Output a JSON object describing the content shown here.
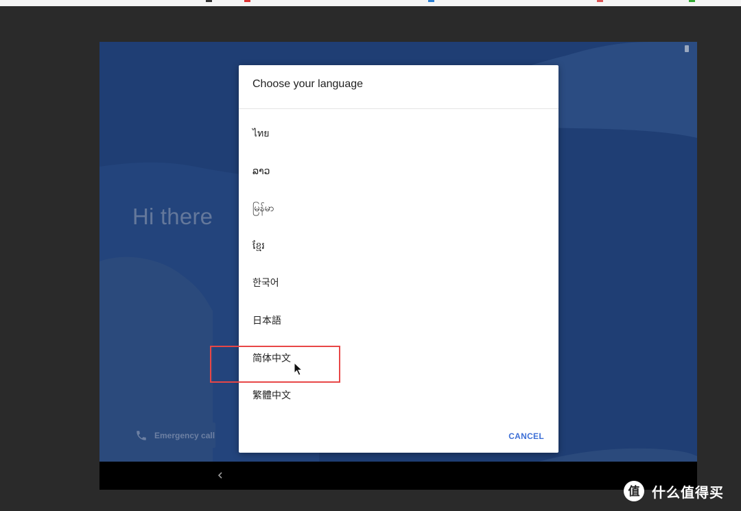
{
  "setup_screen": {
    "greeting": "Hi there",
    "emergency_call_label": "Emergency call",
    "colors": {
      "background": "#1f3e74",
      "greeting_text": "#64789b"
    }
  },
  "language_dialog": {
    "title": "Choose your language",
    "languages": [
      {
        "label": "ไทย"
      },
      {
        "label": "ລາວ"
      },
      {
        "label": "မြန်မာ"
      },
      {
        "label": "ខ្មែរ"
      },
      {
        "label": "한국어"
      },
      {
        "label": "日本語"
      },
      {
        "label": "简体中文",
        "highlighted": true
      },
      {
        "label": "繁體中文"
      }
    ],
    "cancel_label": "CANCEL",
    "colors": {
      "accent": "#3d6fd6",
      "highlight_box": "#e84646"
    }
  },
  "navigation": {
    "icons": [
      "back-icon"
    ]
  },
  "watermark": {
    "text": "什么值得买",
    "badge_glyph": "值"
  }
}
